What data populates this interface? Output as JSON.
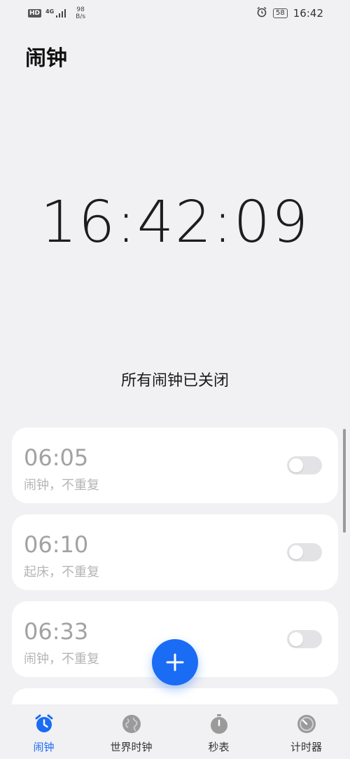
{
  "status_bar": {
    "hd": "HD",
    "network": "4G",
    "speed_value": "98",
    "speed_unit": "B/s",
    "battery": "58",
    "time": "16:42"
  },
  "header": {
    "title": "闹钟"
  },
  "clock": {
    "time": "16:42:09",
    "status_text": "所有闹钟已关闭"
  },
  "alarms": [
    {
      "time": "06:05",
      "label": "闹钟，不重复",
      "enabled": false
    },
    {
      "time": "06:10",
      "label": "起床，不重复",
      "enabled": false
    },
    {
      "time": "06:33",
      "label": "闹钟，不重复",
      "enabled": false
    }
  ],
  "bottom_nav": {
    "items": [
      {
        "label": "闹钟",
        "icon": "alarm-clock-icon",
        "active": true
      },
      {
        "label": "世界时钟",
        "icon": "globe-icon",
        "active": false
      },
      {
        "label": "秒表",
        "icon": "stopwatch-icon",
        "active": false
      },
      {
        "label": "计时器",
        "icon": "timer-icon",
        "active": false
      }
    ]
  },
  "colors": {
    "accent": "#1a6cf5",
    "background": "#f1f1f3",
    "card": "#ffffff",
    "inactive_text": "#a2a2a2",
    "nav_icon_inactive": "#9a9a9a"
  }
}
